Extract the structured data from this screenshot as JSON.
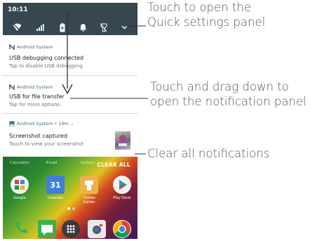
{
  "status_bar": {
    "time": "10:11"
  },
  "quick_icons": [
    "wifi-icon",
    "signal-icon",
    "battery-icon",
    "notification-bell-icon",
    "flashlight-icon",
    "expand-chevron-icon"
  ],
  "notifications": [
    {
      "app": "Android System",
      "title": "USB debugging connected",
      "text": "Tap to disable USB debugging."
    },
    {
      "app": "Android System",
      "title": "USB for file transfer",
      "text": "Tap for more options."
    },
    {
      "app": "Android System • 19m ⌄",
      "title": "Screenshot captured",
      "text": "Touch to view your screenshot"
    }
  ],
  "home": {
    "clear_all": "CLEAR ALL",
    "top_row": [
      "Calculator",
      "Email",
      "Gallery"
    ],
    "apps": [
      "Google",
      "Calendar",
      "Theme Center",
      "Play Store"
    ],
    "calendar_day": "31"
  },
  "callouts": {
    "quick_settings": [
      "Touch to open the",
      "Quick settings panel"
    ],
    "notification_panel": [
      "Touch and drag down to",
      "open the notification panel"
    ],
    "clear_all": "Clear all notifications"
  },
  "colors": {
    "status_bar": "#37474f",
    "accent": "#4a6b82"
  }
}
